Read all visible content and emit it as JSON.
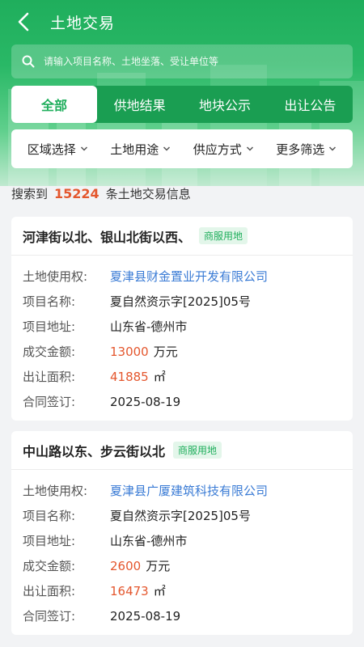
{
  "header": {
    "title": "土地交易"
  },
  "search": {
    "placeholder": "请输入项目名称、土地坐落、受让单位等"
  },
  "tabs": [
    {
      "label": "全部",
      "active": true
    },
    {
      "label": "供地结果",
      "active": false
    },
    {
      "label": "地块公示",
      "active": false
    },
    {
      "label": "出让公告",
      "active": false
    }
  ],
  "filters": [
    {
      "label": "区域选择"
    },
    {
      "label": "土地用途"
    },
    {
      "label": "供应方式"
    },
    {
      "label": "更多筛选"
    }
  ],
  "summary": {
    "prefix": "搜索到",
    "count": "15224",
    "suffix": "条土地交易信息"
  },
  "labels": {
    "user": "土地使用权:",
    "project_name": "项目名称:",
    "address": "项目地址:",
    "amount": "成交金额:",
    "area": "出让面积:",
    "contract": "合同签订:"
  },
  "records": [
    {
      "title": "河津街以北、银山北街以西、",
      "tag": "商服用地",
      "user": "夏津县财金置业开发有限公司",
      "project_name": "夏自然资示字[2025]05号",
      "address": "山东省-德州市",
      "amount": "13000",
      "amount_unit": "万元",
      "area": "41885",
      "area_unit": "㎡",
      "contract": "2025-08-19"
    },
    {
      "title": "中山路以东、步云街以北",
      "tag": "商服用地",
      "user": "夏津县广厦建筑科技有限公司",
      "project_name": "夏自然资示字[2025]05号",
      "address": "山东省-德州市",
      "amount": "2600",
      "amount_unit": "万元",
      "area": "16473",
      "area_unit": "㎡",
      "contract": "2025-08-19"
    }
  ],
  "colors": {
    "primary": "#1fae5c",
    "highlight": "#e4572e",
    "link": "#3a7bd5"
  },
  "icons": {
    "back": "back-arrow-icon",
    "search": "search-icon",
    "dropdown": "chevron-down-icon"
  }
}
